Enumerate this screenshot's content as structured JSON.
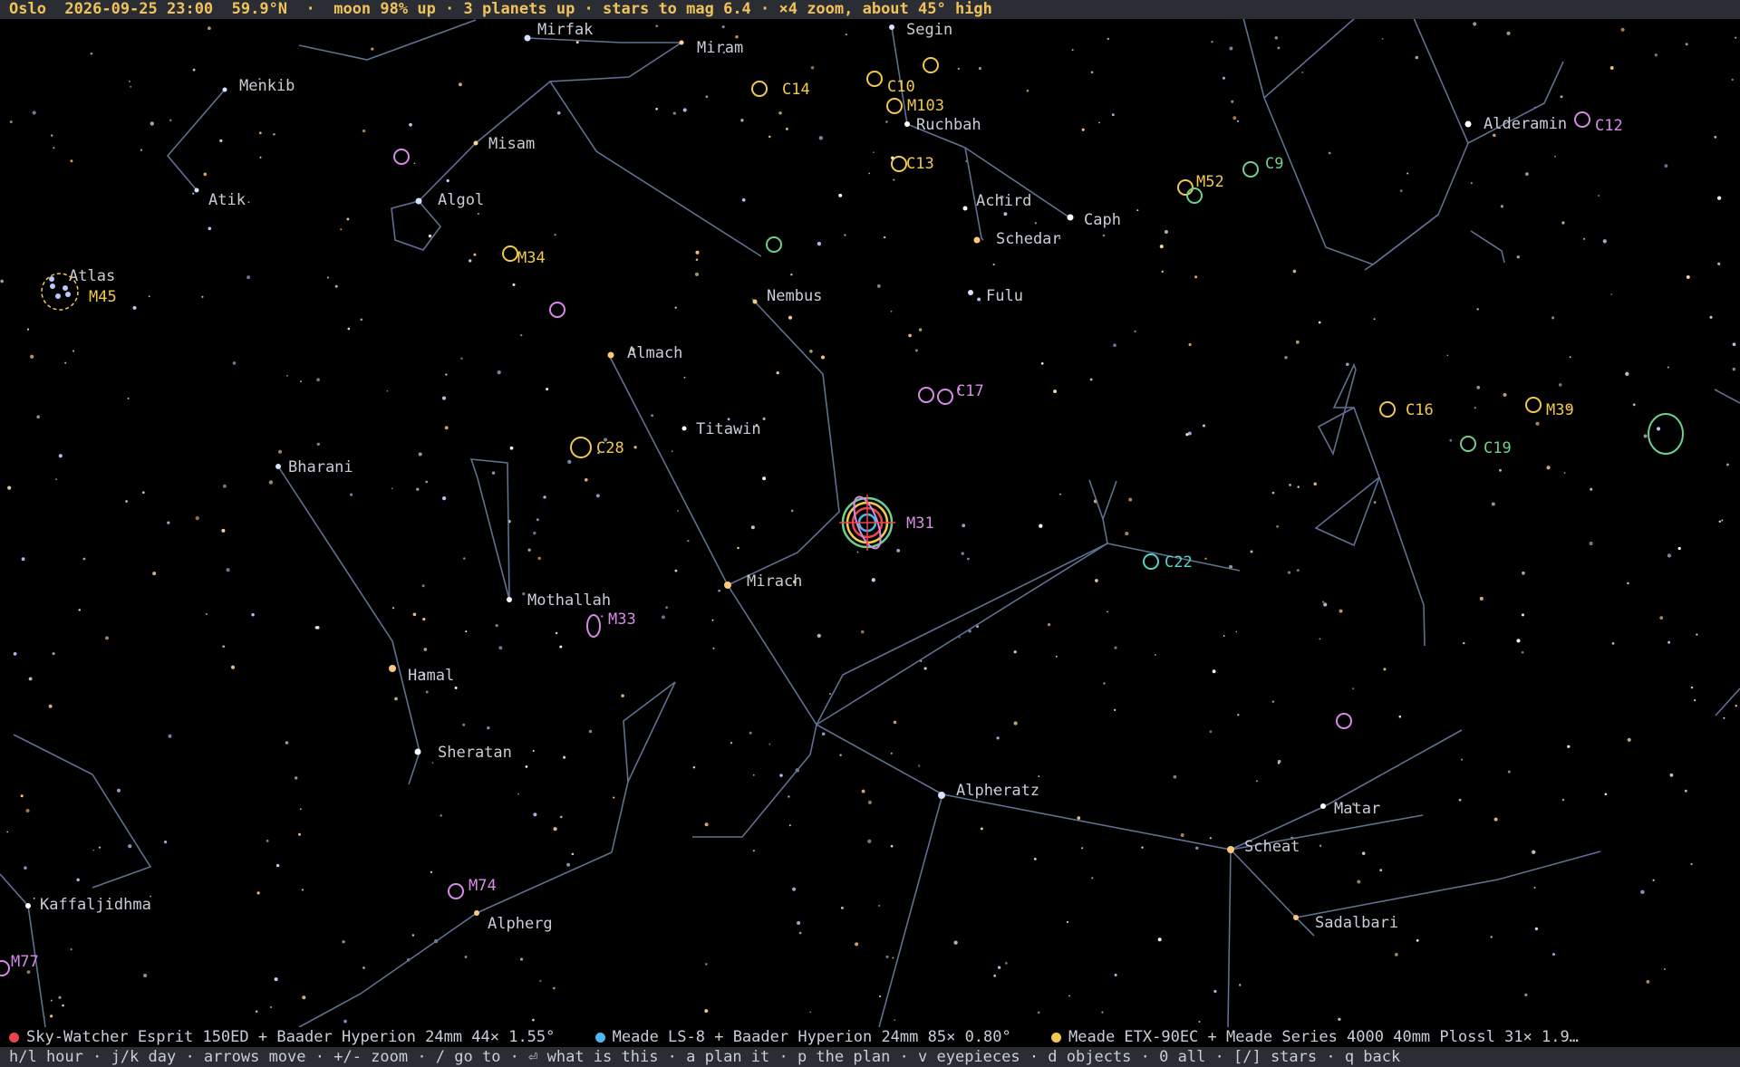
{
  "status": {
    "text": "Oslo  2026-09-25 23:00  59.9°N  ·  moon 98% up · 3 planets up · stars to mag 6.4 · ×4 zoom, about 45° high"
  },
  "scopes": [
    {
      "color": "#e8474b",
      "text": "Sky-Watcher Esprit 150ED + Baader Hyperion 24mm  44×  1.55°"
    },
    {
      "color": "#4fb8f0",
      "text": "Meade LS-8 + Baader Hyperion 24mm  85×  0.80°"
    },
    {
      "color": "#f2c94c",
      "text": "Meade ETX-90EC + Meade Series 4000 40mm Plossl  31×  1.9…"
    }
  ],
  "keys": {
    "text": "h/l hour · j/k day · arrows move · +/- zoom · / go to · ⏎ what is this · a plan it · p the plan · v eyepieces · d objects · 0 all · [/] stars · q back"
  },
  "stars": [
    {
      "name": "Mirfak",
      "color": "#d7e2ff"
    },
    {
      "name": "Miram",
      "color": "#ffd49a"
    },
    {
      "name": "Menkib",
      "color": "#d7e2ff"
    },
    {
      "name": "Misam",
      "color": "#ffd49a"
    },
    {
      "name": "Atik",
      "color": "#d7e2ff"
    },
    {
      "name": "Algol",
      "color": "#d7e2ff"
    },
    {
      "name": "Atlas",
      "color": "#d7e2ff"
    },
    {
      "name": "Segin",
      "color": "#d7e2ff"
    },
    {
      "name": "Ruchbah",
      "color": "#ffffff"
    },
    {
      "name": "Achird",
      "color": "#ffffff"
    },
    {
      "name": "Caph",
      "color": "#ffffff"
    },
    {
      "name": "Schedar",
      "color": "#ffc77a"
    },
    {
      "name": "Fulu",
      "color": "#d7e2ff"
    },
    {
      "name": "Nembus",
      "color": "#ffc77a"
    },
    {
      "name": "Alderamin",
      "color": "#ffffff"
    },
    {
      "name": "Almach",
      "color": "#ffc77a"
    },
    {
      "name": "Titawin",
      "color": "#ffffff"
    },
    {
      "name": "Bharani",
      "color": "#d7e2ff"
    },
    {
      "name": "Mothallah",
      "color": "#ffffff"
    },
    {
      "name": "Mirach",
      "color": "#ffc77a"
    },
    {
      "name": "Hamal",
      "color": "#ffc77a"
    },
    {
      "name": "Sheratan",
      "color": "#ffffff"
    },
    {
      "name": "Alpheratz",
      "color": "#d7e2ff"
    },
    {
      "name": "Matar",
      "color": "#ffffff"
    },
    {
      "name": "Scheat",
      "color": "#ffc77a"
    },
    {
      "name": "Sadalbari",
      "color": "#ffc77a"
    },
    {
      "name": "Kaffaljidhma",
      "color": "#ffffff"
    },
    {
      "name": "Alpherg",
      "color": "#ffc77a"
    }
  ],
  "objects": [
    {
      "name": "C14",
      "color": "#f2c94c"
    },
    {
      "name": "C10",
      "color": "#f2c94c"
    },
    {
      "name": "M103",
      "color": "#f2c94c"
    },
    {
      "name": "C13",
      "color": "#f2c94c"
    },
    {
      "name": "M52",
      "color": "#f2c94c"
    },
    {
      "name": "C9",
      "color": "#6fd08c"
    },
    {
      "name": "C12",
      "color": "#d98ae8"
    },
    {
      "name": "M34",
      "color": "#f2c94c"
    },
    {
      "name": "M45",
      "color": "#f2c94c"
    },
    {
      "name": "C17",
      "color": "#d98ae8"
    },
    {
      "name": "C16",
      "color": "#f2c94c"
    },
    {
      "name": "M39",
      "color": "#f2c94c"
    },
    {
      "name": "C19",
      "color": "#6fd08c"
    },
    {
      "name": "C28",
      "color": "#f2c94c"
    },
    {
      "name": "M31",
      "color": "#d98ae8"
    },
    {
      "name": "C22",
      "color": "#4fd6c8"
    },
    {
      "name": "M33",
      "color": "#d98ae8"
    },
    {
      "name": "M74",
      "color": "#d98ae8"
    },
    {
      "name": "M77",
      "color": "#d98ae8"
    }
  ]
}
